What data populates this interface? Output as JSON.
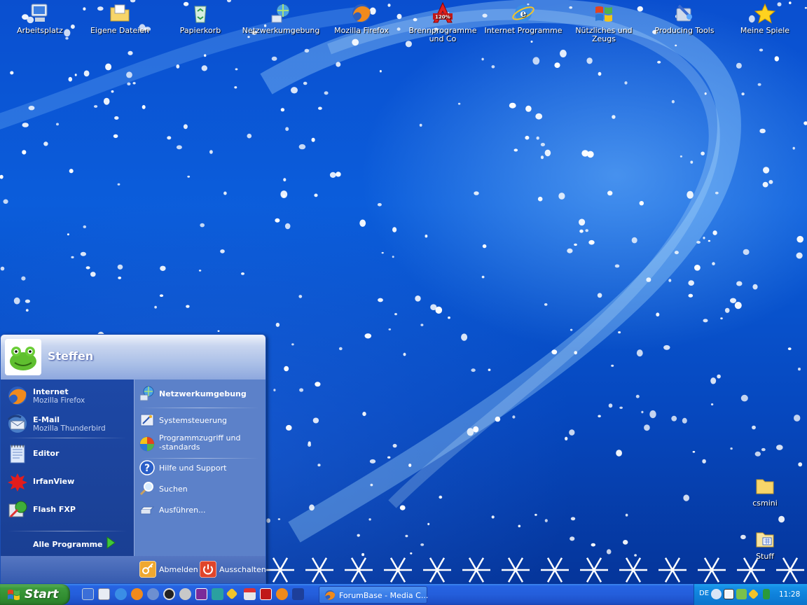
{
  "desktop_icons": [
    {
      "label": "Arbeitsplatz",
      "icon": "my-computer-icon"
    },
    {
      "label": "Eigene Dateien",
      "icon": "my-documents-icon"
    },
    {
      "label": "Papierkorb",
      "icon": "recycle-bin-icon"
    },
    {
      "label": "Netzwerkumgebung",
      "icon": "network-places-icon"
    },
    {
      "label": "Mozilla Firefox",
      "icon": "firefox-icon"
    },
    {
      "label": "Brennprogramme und Co",
      "icon": "burning-software-icon"
    },
    {
      "label": "Internet Programme",
      "icon": "internet-explorer-icon"
    },
    {
      "label": "Nützliches und Zeugs",
      "icon": "windows-flag-icon"
    },
    {
      "label": "Producing Tools",
      "icon": "tools-icon"
    },
    {
      "label": "Meine Spiele",
      "icon": "star-icon"
    },
    {
      "label": "csmini",
      "icon": "folder-icon"
    },
    {
      "label": "Stuff",
      "icon": "folder-icon"
    }
  ],
  "start_menu": {
    "username": "Steffen",
    "pinned": [
      {
        "title": "Internet",
        "subtitle": "Mozilla Firefox"
      },
      {
        "title": "E-Mail",
        "subtitle": "Mozilla Thunderbird"
      }
    ],
    "recent": [
      {
        "title": "Editor"
      },
      {
        "title": "IrfanView"
      },
      {
        "title": "Flash FXP"
      }
    ],
    "all_programs": "Alle Programme",
    "right_items": [
      "Netzwerkumgebung",
      "Systemsteuerung",
      "Programmzugriff und",
      "-standards",
      "Hilfe und Support",
      "Suchen",
      "Ausführen..."
    ],
    "logoff": "Abmelden",
    "shutdown": "Ausschalten"
  },
  "taskbar": {
    "start_label": "Start",
    "window_button": "ForumBase - Media C...",
    "language": "DE",
    "clock": "11:28"
  },
  "colors": {
    "desktop_blue": "#0b5ddb",
    "start_green": "#3c9b3c",
    "taskbar_blue": "#245edb",
    "tray_blue": "#0f82dc"
  }
}
